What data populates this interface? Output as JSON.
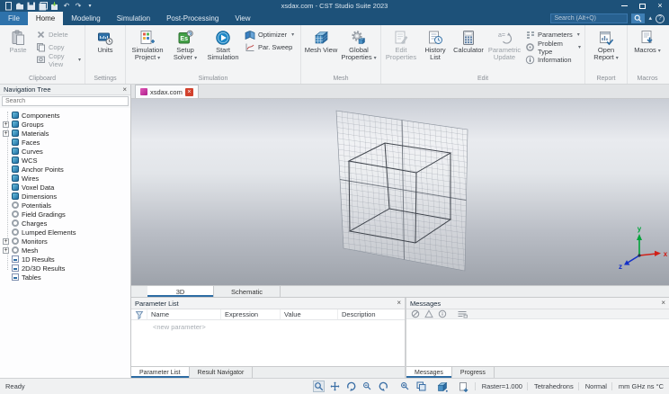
{
  "window": {
    "title": "xsdax.com - CST Studio Suite 2023"
  },
  "menu_tabs": [
    {
      "label": "File",
      "cls": "file"
    },
    {
      "label": "Home",
      "active": true
    },
    {
      "label": "Modeling"
    },
    {
      "label": "Simulation"
    },
    {
      "label": "Post-Processing"
    },
    {
      "label": "View"
    }
  ],
  "search": {
    "placeholder": "Search (Alt+Q)"
  },
  "ribbon": {
    "clipboard": {
      "paste": "Paste",
      "delete": "Delete",
      "copy": "Copy",
      "copy_view": "Copy View",
      "label": "Clipboard"
    },
    "settings": {
      "units": "Units",
      "label": "Settings"
    },
    "simulation": {
      "simulation_project": "Simulation Project",
      "setup_solver": "Setup Solver",
      "setup_solver_icon_text": "Es",
      "start_simulation": "Start Simulation",
      "optimizer": "Optimizer",
      "par_sweep": "Par. Sweep",
      "label": "Simulation"
    },
    "mesh": {
      "mesh_view": "Mesh View",
      "global_properties": "Global Properties",
      "label": "Mesh"
    },
    "edit": {
      "edit_properties": "Edit Properties",
      "history_list": "History List",
      "calculator": "Calculator",
      "parametric_update": "Parametric Update",
      "parametric_icon_text": "a=",
      "parameters": "Parameters",
      "problem_type": "Problem Type",
      "information": "Information",
      "label": "Edit"
    },
    "report": {
      "open_report": "Open Report",
      "label": "Report"
    },
    "macros": {
      "macros": "Macros",
      "label": "Macros"
    }
  },
  "nav_tree": {
    "title": "Navigation Tree",
    "search_placeholder": "Search",
    "items": [
      {
        "label": "Components",
        "icon": "shield",
        "expand": false
      },
      {
        "label": "Groups",
        "icon": "shield",
        "expand": true
      },
      {
        "label": "Materials",
        "icon": "shield",
        "expand": true
      },
      {
        "label": "Faces",
        "icon": "shield",
        "expand": false
      },
      {
        "label": "Curves",
        "icon": "shield",
        "expand": false
      },
      {
        "label": "WCS",
        "icon": "shield",
        "expand": false
      },
      {
        "label": "Anchor Points",
        "icon": "shield",
        "expand": false
      },
      {
        "label": "Wires",
        "icon": "shield",
        "expand": false
      },
      {
        "label": "Voxel Data",
        "icon": "shield",
        "expand": false
      },
      {
        "label": "Dimensions",
        "icon": "shield",
        "expand": false
      },
      {
        "label": "Potentials",
        "icon": "circle",
        "expand": false
      },
      {
        "label": "Field Gradings",
        "icon": "circle",
        "expand": false
      },
      {
        "label": "Charges",
        "icon": "circle",
        "expand": false
      },
      {
        "label": "Lumped Elements",
        "icon": "circle",
        "expand": false
      },
      {
        "label": "Monitors",
        "icon": "circle",
        "expand": true
      },
      {
        "label": "Mesh",
        "icon": "circle",
        "expand": true
      },
      {
        "label": "1D Results",
        "icon": "chart",
        "expand": false
      },
      {
        "label": "2D/3D Results",
        "icon": "chart",
        "expand": false
      },
      {
        "label": "Tables",
        "icon": "chart",
        "expand": false
      }
    ]
  },
  "document_tab": {
    "label": "xsdax.com"
  },
  "viewport": {
    "axes": {
      "x": "x",
      "y": "y",
      "z": "z"
    }
  },
  "view_tabs": [
    {
      "label": "3D",
      "active": true
    },
    {
      "label": "Schematic"
    }
  ],
  "parameter_list": {
    "title": "Parameter List",
    "columns": [
      "Name",
      "Expression",
      "Value",
      "Description"
    ],
    "new_row": "<new parameter>",
    "tabs": [
      {
        "label": "Parameter List",
        "active": true
      },
      {
        "label": "Result Navigator"
      }
    ]
  },
  "messages": {
    "title": "Messages",
    "tabs": [
      {
        "label": "Messages",
        "active": true
      },
      {
        "label": "Progress"
      }
    ]
  },
  "status_bar": {
    "ready": "Ready",
    "segments": [
      "Raster=1.000",
      "Tetrahedrons",
      "Normal",
      "mm GHz ns °C"
    ]
  },
  "colors": {
    "titlebar": "#1d5179",
    "accent": "#2d6ca3",
    "tab_underline": "#2d6ca3",
    "close_tab": "#d2422e"
  }
}
